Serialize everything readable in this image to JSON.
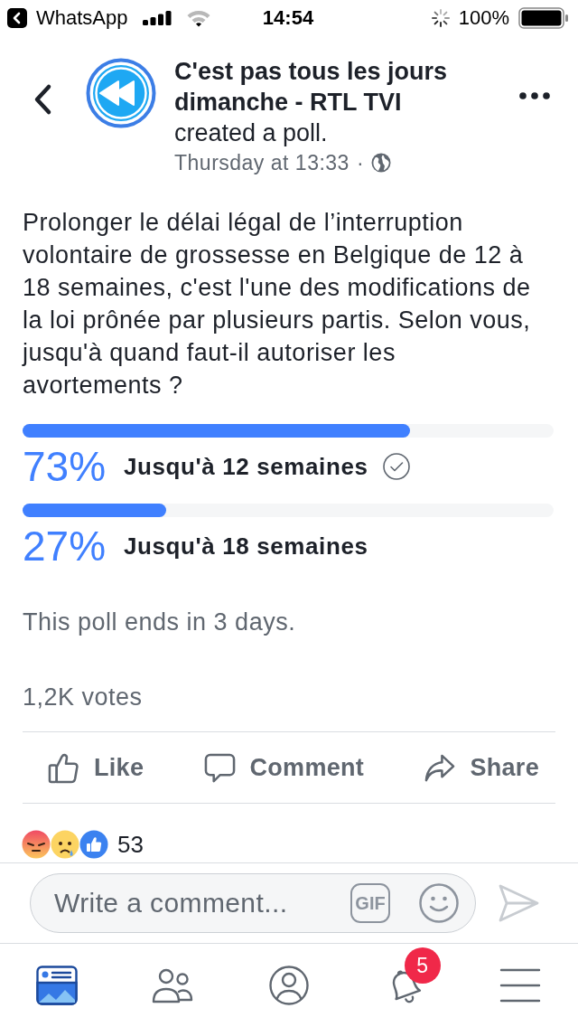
{
  "status_bar": {
    "back_app": "WhatsApp",
    "time": "14:54",
    "battery": "100%"
  },
  "header": {
    "page_name": "C'est pas tous les jours dimanche - RTL TVI",
    "action": "created a poll.",
    "timestamp": "Thursday at 13:33",
    "separator": "·"
  },
  "post": {
    "text": "Prolonger le délai légal de l’interruption volontaire de grossesse en Belgique de 12 à 18 semaines, c'est l'une des modifications de la loi prônée par plusieurs partis. Selon vous, jusqu'à quand faut-il autoriser les avortements ?"
  },
  "poll": {
    "options": [
      {
        "percent": "73%",
        "label": "Jusqu'à 12 semaines",
        "level": 0.73,
        "selected": true
      },
      {
        "percent": "27%",
        "label": "Jusqu'à 18 semaines",
        "level": 0.27,
        "selected": false
      }
    ],
    "ends": "This poll ends in 3 days.",
    "votes": "1,2K votes"
  },
  "actions": [
    {
      "kind": "like",
      "label": "Like"
    },
    {
      "kind": "comment",
      "label": "Comment"
    },
    {
      "kind": "share",
      "label": "Share"
    }
  ],
  "reactions": {
    "icons": [
      {
        "kind": "angry"
      },
      {
        "kind": "sad"
      },
      {
        "kind": "like"
      }
    ],
    "count": "53"
  },
  "comment_bar": {
    "placeholder": "Write a comment...",
    "gif": "GIF"
  },
  "tab_bar": {
    "tabs": [
      {
        "kind": "feed",
        "selected": true
      },
      {
        "kind": "friends",
        "selected": false
      },
      {
        "kind": "profile",
        "selected": false
      },
      {
        "kind": "notifications",
        "selected": false,
        "badge": "5"
      },
      {
        "kind": "menu",
        "selected": false
      }
    ]
  }
}
